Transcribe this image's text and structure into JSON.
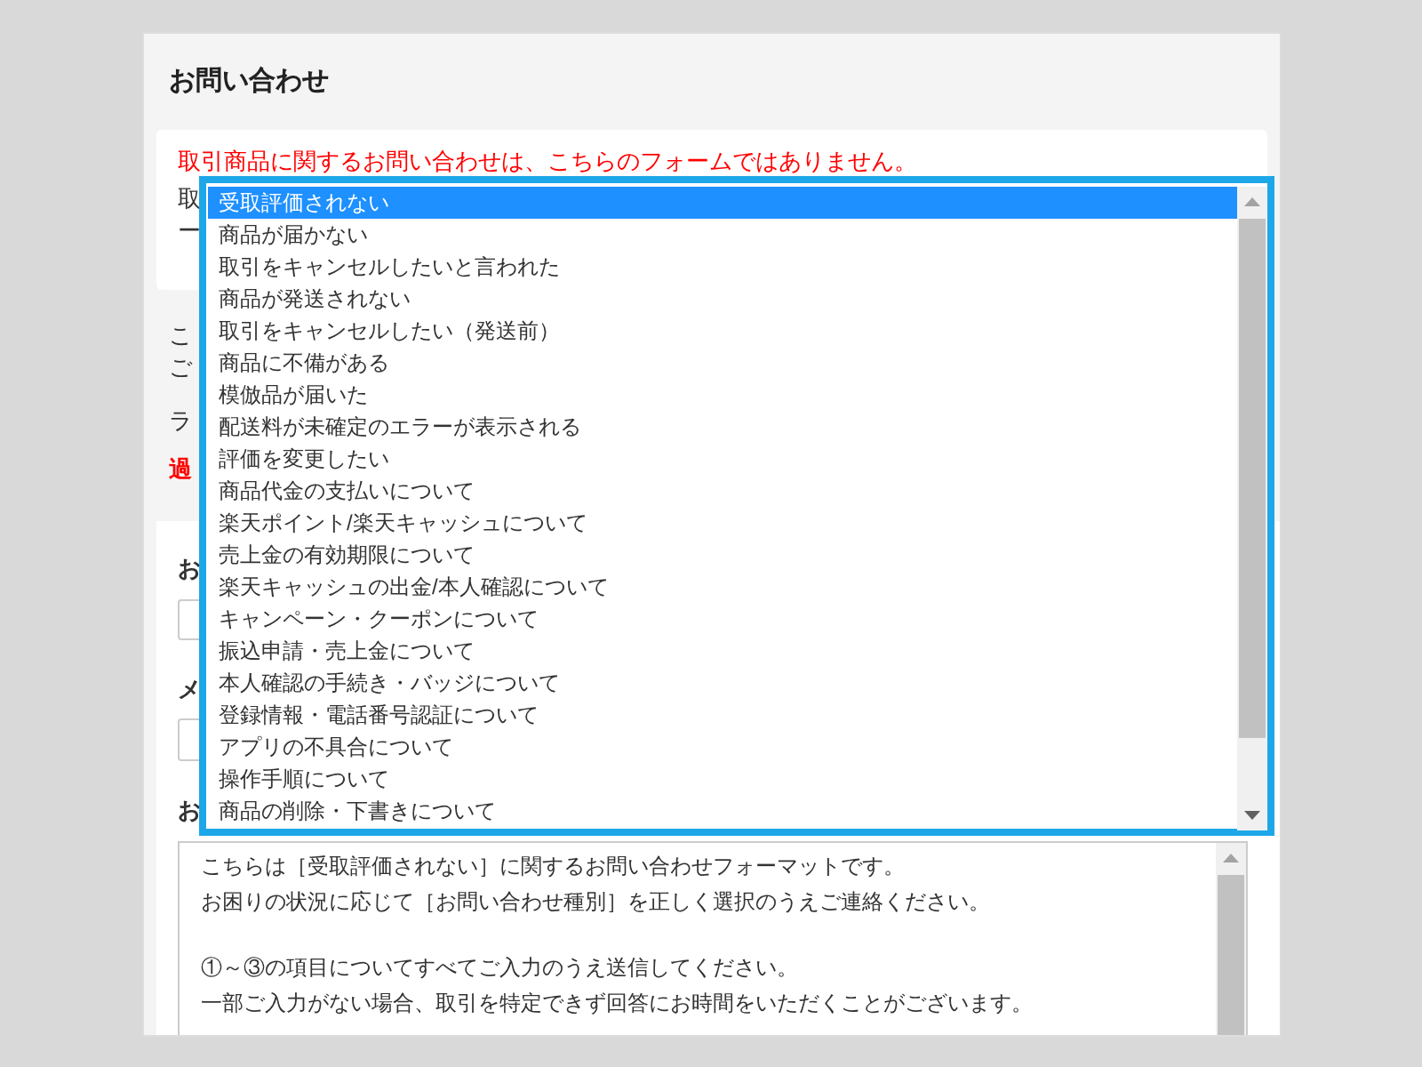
{
  "title": "お問い合わせ",
  "notice": {
    "warning": "取引商品に関するお問い合わせは、こちらのフォームではありません。",
    "lines": [
      "取",
      "ー"
    ]
  },
  "intro": {
    "lines": [
      "こ",
      "ご"
    ],
    "label": "ラ",
    "alert": "過"
  },
  "form": {
    "fields": [
      {
        "label": "お",
        "kind": "input"
      },
      {
        "label": "メ",
        "kind": "input"
      },
      {
        "label": "お",
        "kind": "textarea"
      }
    ],
    "message": [
      [
        "こちらは［受取評価されない］に関するお問い合わせフォーマットです。",
        "お困りの状況に応じて［お問い合わせ種別］を正しく選択のうえご連絡ください。"
      ],
      [
        "①～③の項目についてすべてご入力のうえ送信してください。",
        "一部ご入力がない場合、取引を特定できず回答にお時間をいただくことがございます。"
      ]
    ]
  },
  "dropdown": {
    "options": [
      {
        "label": "受取評価されない",
        "selected": true
      },
      {
        "label": "商品が届かない",
        "selected": false
      },
      {
        "label": "取引をキャンセルしたいと言われた",
        "selected": false
      },
      {
        "label": "商品が発送されない",
        "selected": false
      },
      {
        "label": "取引をキャンセルしたい（発送前）",
        "selected": false
      },
      {
        "label": "商品に不備がある",
        "selected": false
      },
      {
        "label": "模倣品が届いた",
        "selected": false
      },
      {
        "label": "配送料が未確定のエラーが表示される",
        "selected": false
      },
      {
        "label": "評価を変更したい",
        "selected": false
      },
      {
        "label": "商品代金の支払いについて",
        "selected": false
      },
      {
        "label": "楽天ポイント/楽天キャッシュについて",
        "selected": false
      },
      {
        "label": "売上金の有効期限について",
        "selected": false
      },
      {
        "label": "楽天キャッシュの出金/本人確認について",
        "selected": false
      },
      {
        "label": "キャンペーン・クーポンについて",
        "selected": false
      },
      {
        "label": "振込申請・売上金について",
        "selected": false
      },
      {
        "label": "本人確認の手続き・バッジについて",
        "selected": false
      },
      {
        "label": "登録情報・電話番号認証について",
        "selected": false
      },
      {
        "label": "アプリの不具合について",
        "selected": false
      },
      {
        "label": "操作手順について",
        "selected": false
      },
      {
        "label": "商品の削除・下書きについて",
        "selected": false
      }
    ]
  }
}
